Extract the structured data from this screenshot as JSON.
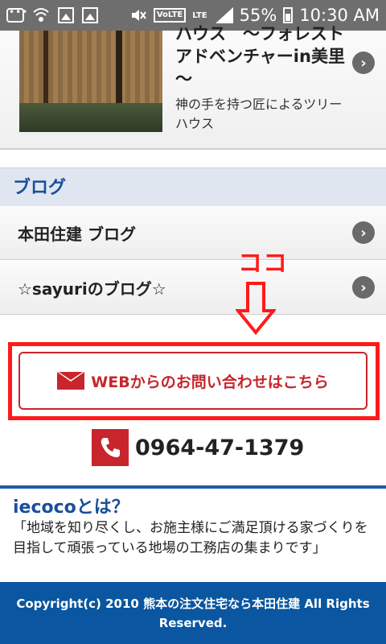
{
  "status_bar": {
    "icons": [
      "chat-icon",
      "wifi-call-icon",
      "image-icon",
      "gallery-icon",
      "mute-icon",
      "volte-icon",
      "lte-icon",
      "signal-icon",
      "battery-icon"
    ],
    "volte": "VoLTE",
    "lte": "LTE",
    "battery": "55%",
    "time": "10:30 AM"
  },
  "article": {
    "title": "ハウス　～フォレストアドベンチャーin美里～",
    "description": "神の手を持つ匠によるツリーハウス",
    "chevron": "›"
  },
  "blog": {
    "heading": "ブログ",
    "items": [
      {
        "label": "本田住建 ブログ",
        "chevron": "›"
      },
      {
        "label": "☆sayuriのブログ☆",
        "chevron": "›"
      }
    ]
  },
  "annotation": {
    "text": "ココ",
    "color": "#ff1a1a"
  },
  "contact": {
    "button_label": "WEBからのお問い合わせはこちら",
    "phone": "0964-47-1379",
    "accent": "#c8252c"
  },
  "about": {
    "title": "iecocoとは？",
    "text": "「地域を知り尽くし、お施主様にご満足頂ける家づくりを目指して頑張っている地場の工務店の集まりです」"
  },
  "footer": {
    "copyright": "Copyright(c) 2010 熊本の注文住宅なら本田住建 All Rights Reserved.",
    "bg_color": "#0a56a0"
  }
}
